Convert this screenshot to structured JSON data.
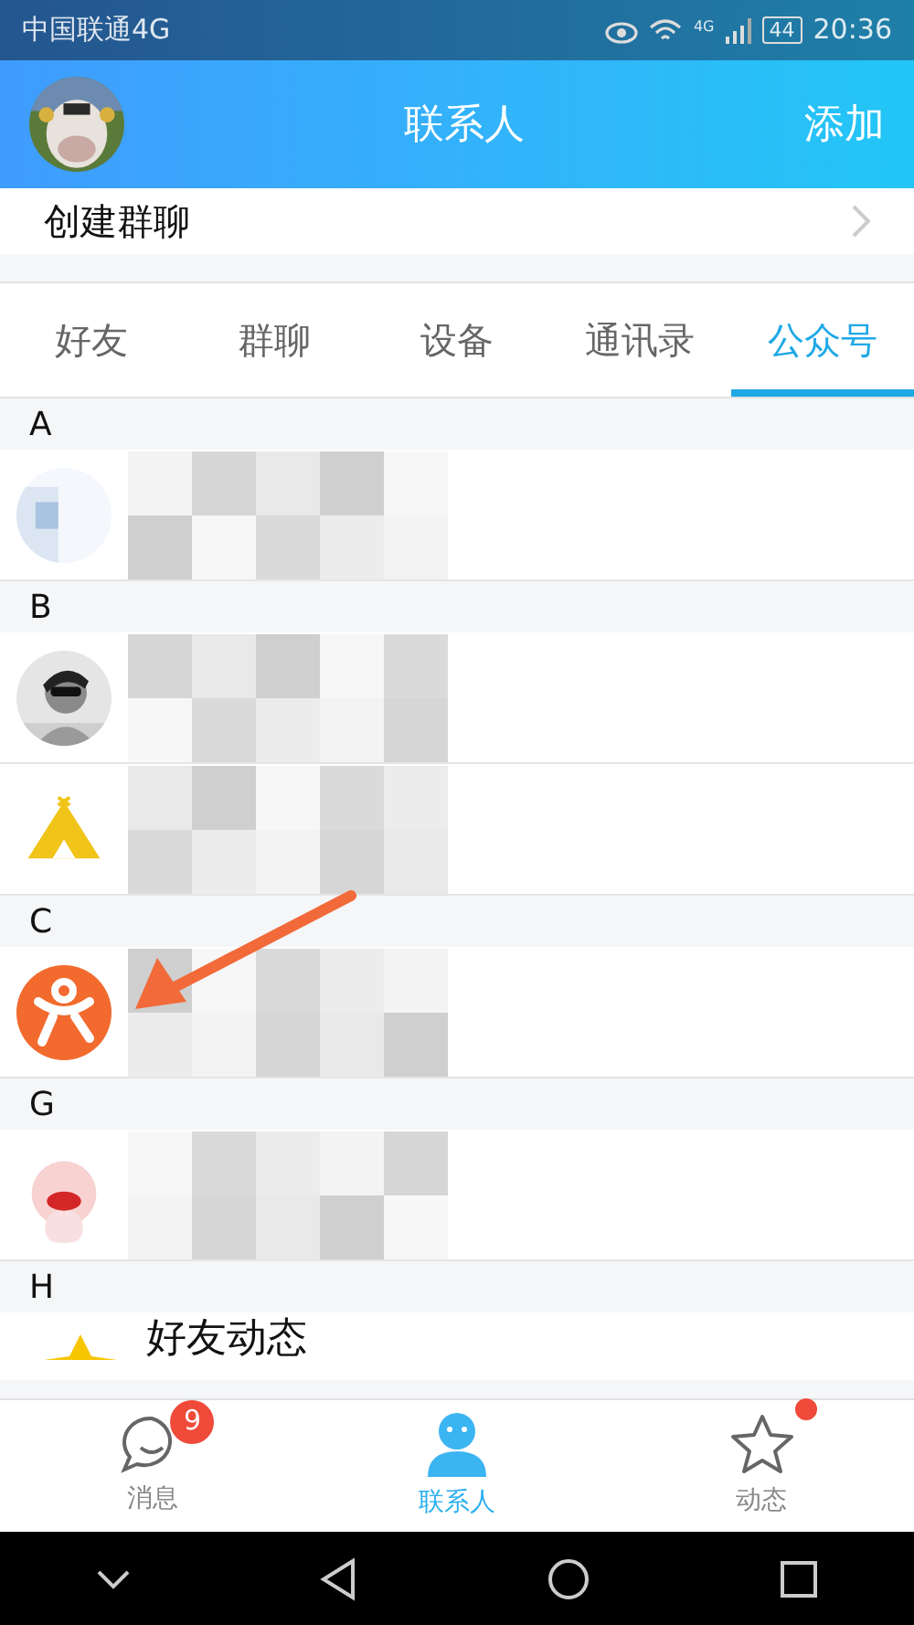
{
  "status_bar": {
    "carrier": "中国联通4G",
    "network": "4G",
    "battery": "44",
    "time": "20:36"
  },
  "header": {
    "title": "联系人",
    "action": "添加"
  },
  "create_group": {
    "label": "创建群聊"
  },
  "tabs": [
    {
      "label": "好友",
      "selected": false
    },
    {
      "label": "群聊",
      "selected": false
    },
    {
      "label": "设备",
      "selected": false
    },
    {
      "label": "通讯录",
      "selected": false
    },
    {
      "label": "公众号",
      "selected": true
    }
  ],
  "sections": [
    {
      "letter": "A"
    },
    {
      "letter": "B"
    },
    {
      "letter": "C"
    },
    {
      "letter": "G"
    },
    {
      "letter": "H",
      "contacts": [
        {
          "kind": "named",
          "name": "好友动态"
        }
      ]
    }
  ],
  "annotation": {
    "kind": "arrow"
  },
  "bottom_nav": [
    {
      "label": "消息",
      "badge": "9",
      "dot": false,
      "selected": false
    },
    {
      "label": "联系人",
      "dot": false,
      "selected": true
    },
    {
      "label": "动态",
      "dot": true,
      "selected": false
    }
  ]
}
